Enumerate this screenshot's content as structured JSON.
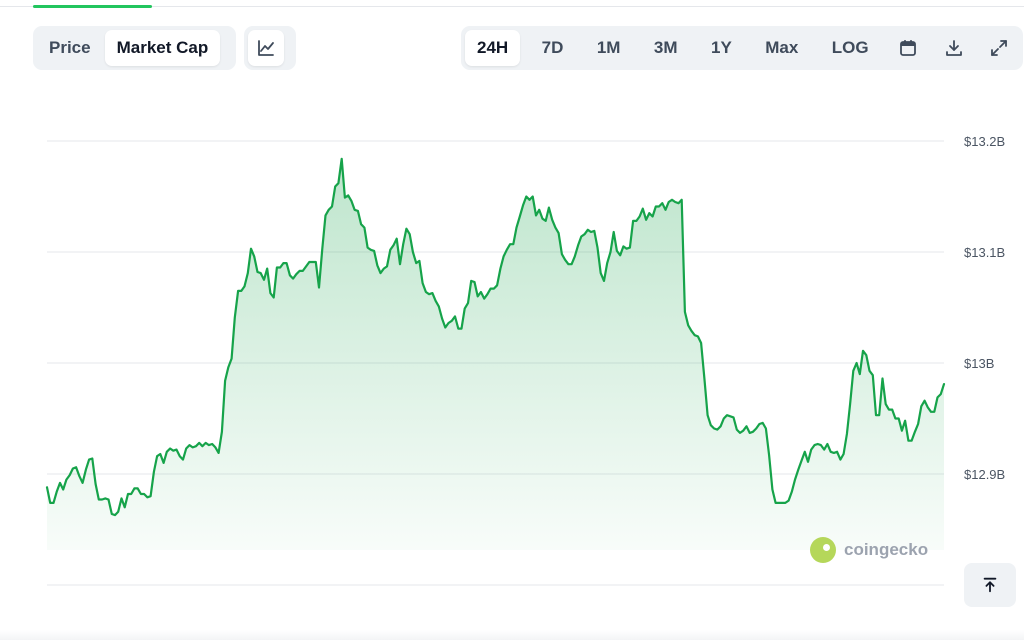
{
  "toolbar": {
    "left_tabs": [
      {
        "label": "Price",
        "active": false
      },
      {
        "label": "Market Cap",
        "active": true
      }
    ],
    "chart_style_icon": "line-chart-icon",
    "ranges": [
      {
        "label": "24H",
        "active": true
      },
      {
        "label": "7D",
        "active": false
      },
      {
        "label": "1M",
        "active": false
      },
      {
        "label": "3M",
        "active": false
      },
      {
        "label": "1Y",
        "active": false
      },
      {
        "label": "Max",
        "active": false
      },
      {
        "label": "LOG",
        "active": false
      }
    ],
    "icons": [
      "calendar-icon",
      "download-icon",
      "expand-icon"
    ]
  },
  "watermark": {
    "text": "coingecko",
    "icon": "coingecko-logo-icon"
  },
  "scroll_top_icon": "arrow-up-icon",
  "colors": {
    "line": "#16a34a",
    "fill_top": "#bbf7d0",
    "grid": "#e5e7eb",
    "accent": "#22c55e"
  },
  "chart_data": {
    "type": "area",
    "title": "",
    "xlabel": "",
    "ylabel": "",
    "y_unit": "USD",
    "ylim": [
      12.85,
      13.22
    ],
    "y_ticks": [
      {
        "value": 13.2,
        "label": "$13.2B"
      },
      {
        "value": 13.1,
        "label": "$13.1B"
      },
      {
        "value": 13.0,
        "label": "$13B"
      },
      {
        "value": 12.9,
        "label": "$12.9B"
      }
    ],
    "grid": true,
    "series": [
      {
        "values": [
          12.888,
          12.874,
          12.874,
          12.884,
          12.892,
          12.886,
          12.895,
          12.899,
          12.905,
          12.906,
          12.898,
          12.892,
          12.904,
          12.913,
          12.914,
          12.891,
          12.877,
          12.877,
          12.878,
          12.877,
          12.864,
          12.863,
          12.866,
          12.878,
          12.87,
          12.882,
          12.882,
          12.887,
          12.887,
          12.882,
          12.882,
          12.879,
          12.88,
          12.902,
          12.916,
          12.918,
          12.91,
          12.92,
          12.923,
          12.921,
          12.922,
          12.916,
          12.913,
          12.923,
          12.926,
          12.924,
          12.925,
          12.928,
          12.925,
          12.928,
          12.926,
          12.927,
          12.924,
          12.919,
          12.938,
          12.984,
          12.996,
          13.004,
          13.041,
          13.065,
          13.065,
          13.069,
          13.081,
          13.103,
          13.096,
          13.082,
          13.081,
          13.075,
          13.085,
          13.063,
          13.059,
          13.086,
          13.086,
          13.09,
          13.09,
          13.079,
          13.076,
          13.08,
          13.083,
          13.083,
          13.087,
          13.091,
          13.091,
          13.091,
          13.068,
          13.103,
          13.133,
          13.138,
          13.141,
          13.159,
          13.162,
          13.184,
          13.149,
          13.151,
          13.146,
          13.138,
          13.137,
          13.125,
          13.122,
          13.104,
          13.102,
          13.101,
          13.088,
          13.081,
          13.085,
          13.087,
          13.102,
          13.106,
          13.112,
          13.089,
          13.107,
          13.121,
          13.116,
          13.1,
          13.09,
          13.092,
          13.072,
          13.064,
          13.062,
          13.063,
          13.056,
          13.051,
          13.04,
          13.032,
          13.036,
          13.038,
          13.042,
          13.031,
          13.031,
          13.049,
          13.054,
          13.074,
          13.073,
          13.06,
          13.064,
          13.058,
          13.062,
          13.067,
          13.067,
          13.07,
          13.085,
          13.096,
          13.102,
          13.107,
          13.107,
          13.122,
          13.132,
          13.142,
          13.15,
          13.147,
          13.15,
          13.133,
          13.138,
          13.13,
          13.128,
          13.14,
          13.129,
          13.122,
          13.117,
          13.098,
          13.093,
          13.089,
          13.089,
          13.096,
          13.106,
          13.114,
          13.116,
          13.12,
          13.118,
          13.119,
          13.104,
          13.081,
          13.074,
          13.09,
          13.1,
          13.118,
          13.101,
          13.097,
          13.105,
          13.103,
          13.104,
          13.128,
          13.128,
          13.132,
          13.139,
          13.129,
          13.135,
          13.132,
          13.141,
          13.141,
          13.144,
          13.138,
          13.145,
          13.147,
          13.145,
          13.144,
          13.147,
          13.046,
          13.034,
          13.029,
          13.025,
          13.024,
          13.018,
          12.986,
          12.953,
          12.944,
          12.941,
          12.94,
          12.943,
          12.95,
          12.953,
          12.952,
          12.951,
          12.94,
          12.937,
          12.939,
          12.943,
          12.937,
          12.938,
          12.941,
          12.945,
          12.946,
          12.941,
          12.917,
          12.886,
          12.874,
          12.874,
          12.874,
          12.874,
          12.876,
          12.884,
          12.895,
          12.904,
          12.912,
          12.92,
          12.911,
          12.922,
          12.926,
          12.927,
          12.926,
          12.922,
          12.927,
          12.92,
          12.919,
          12.92,
          12.913,
          12.918,
          12.936,
          12.963,
          12.993,
          13.0,
          12.99,
          13.011,
          13.007,
          12.993,
          12.989,
          12.953,
          12.953,
          12.986,
          12.963,
          12.958,
          12.958,
          12.95,
          12.95,
          12.939,
          12.948,
          12.93,
          12.93,
          12.938,
          12.945,
          12.961,
          12.966,
          12.96,
          12.956,
          12.956,
          12.969,
          12.972,
          12.981
        ]
      }
    ]
  }
}
